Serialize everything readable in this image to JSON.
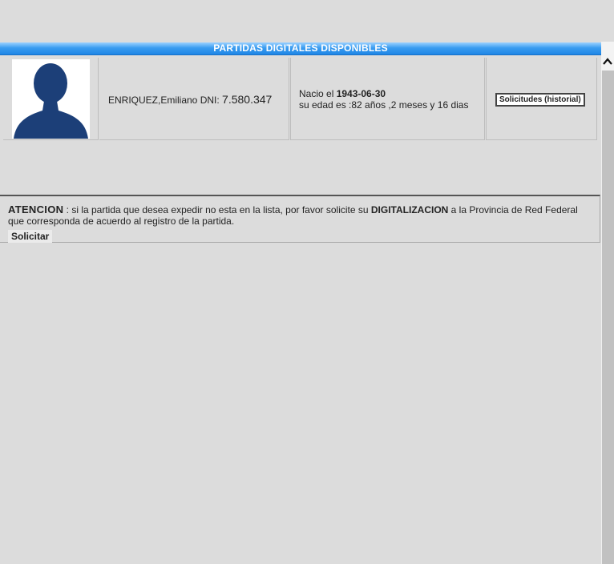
{
  "header": {
    "title": "PARTIDAS DIGITALES DISPONIBLES"
  },
  "person": {
    "avatar_icon": "user-silhouette-icon",
    "name": "ENRIQUEZ,Emiliano DNI: ",
    "dni": "7.580.347",
    "birth_label": "Nacio el ",
    "birth_date": "1943-06-30",
    "age_text": "su edad es :82 años ,2 meses y 16 dias"
  },
  "actions": {
    "history_button": "Solicitudes (historial)"
  },
  "notice": {
    "label": "ATENCION",
    "text_part1": " : si la partida que desea expedir no esta en la lista, por favor solicite su ",
    "highlight": "DIGITALIZACION",
    "text_part2": " a la Provincia de Red Federal que corresponda de acuerdo al registro de la partida.",
    "request_button": "Solicitar"
  },
  "colors": {
    "banner": "#1f86e6",
    "avatar": "#1c3f78",
    "background": "#dcdcdc"
  }
}
